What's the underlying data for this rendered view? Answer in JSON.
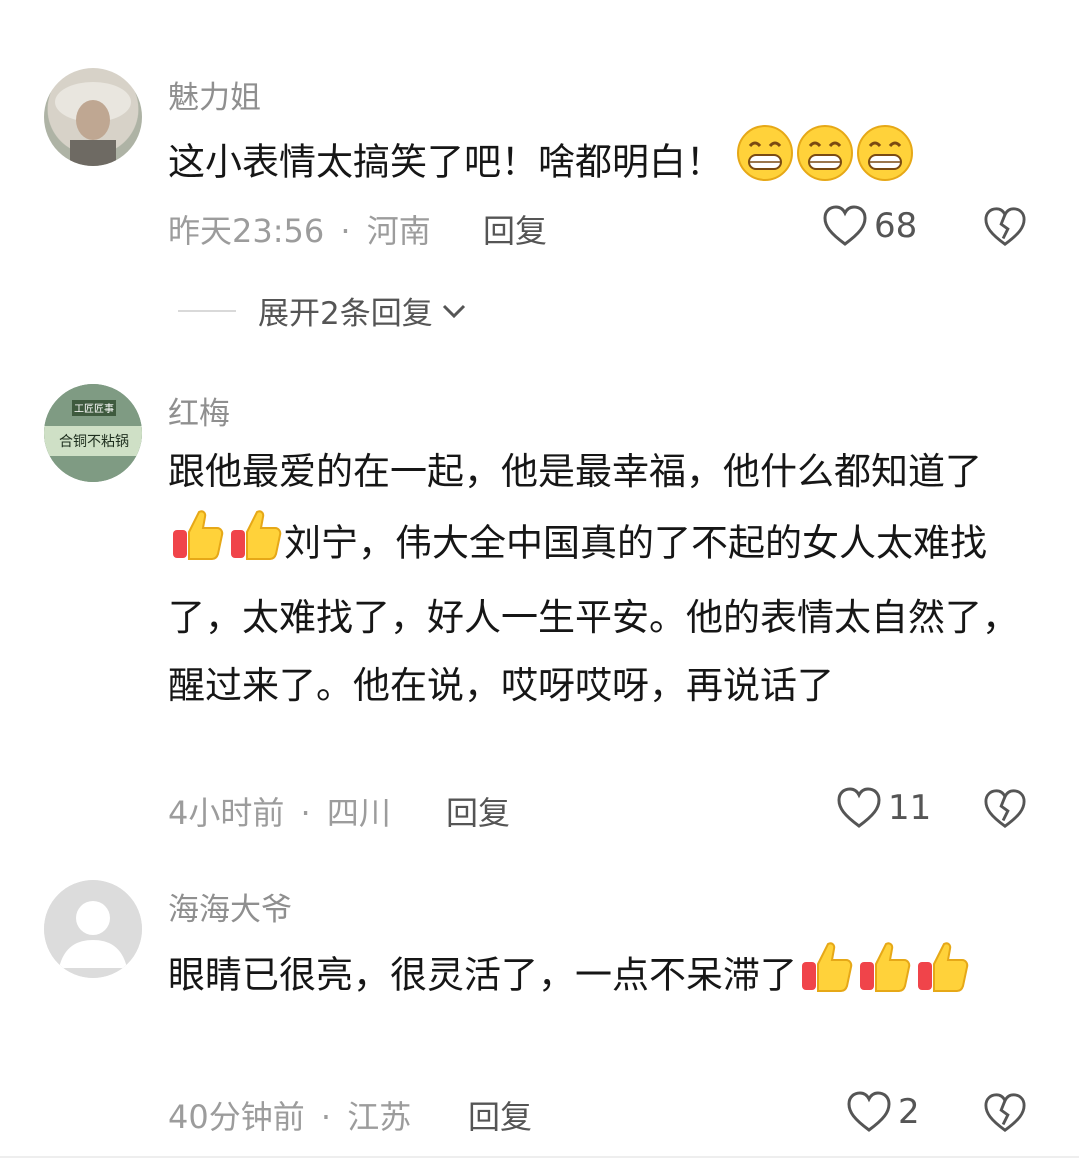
{
  "comments": [
    {
      "username": "魅力姐",
      "text": "这小表情太搞笑了吧！啥都明白！",
      "emojis": [
        "grin-emoji",
        "grin-emoji",
        "grin-emoji"
      ],
      "time": "昨天23:56",
      "location": "河南",
      "reply_label": "回复",
      "likes": "68",
      "expand_label": "展开2条回复"
    },
    {
      "username": "红梅",
      "avatar_text_top": "工匠匠事",
      "avatar_text_main": "合铜不粘锅",
      "text_before": "跟他最爱的在一起，他是最幸福，他什么都知道了",
      "emojis": [
        "thumbs-up-emoji",
        "thumbs-up-emoji"
      ],
      "text_after": "刘宁，伟大全中国真的了不起的女人太难找了，太难找了，好人一生平安。他的表情太自然了，醒过来了。他在说，哎呀哎呀，再说话了",
      "time": "4小时前",
      "location": "四川",
      "reply_label": "回复",
      "likes": "11"
    },
    {
      "username": "海海大爷",
      "text": "眼睛已很亮，很灵活了，一点不呆滞了",
      "emojis": [
        "thumbs-up-emoji",
        "thumbs-up-emoji",
        "thumbs-up-emoji"
      ],
      "time": "40分钟前",
      "location": "江苏",
      "reply_label": "回复",
      "likes": "2"
    }
  ],
  "separator": "·",
  "colors": {
    "meta": "#9c9c9c",
    "text": "#161616",
    "emoji_yellow": "#ffd23a",
    "emoji_red": "#f0444a"
  }
}
